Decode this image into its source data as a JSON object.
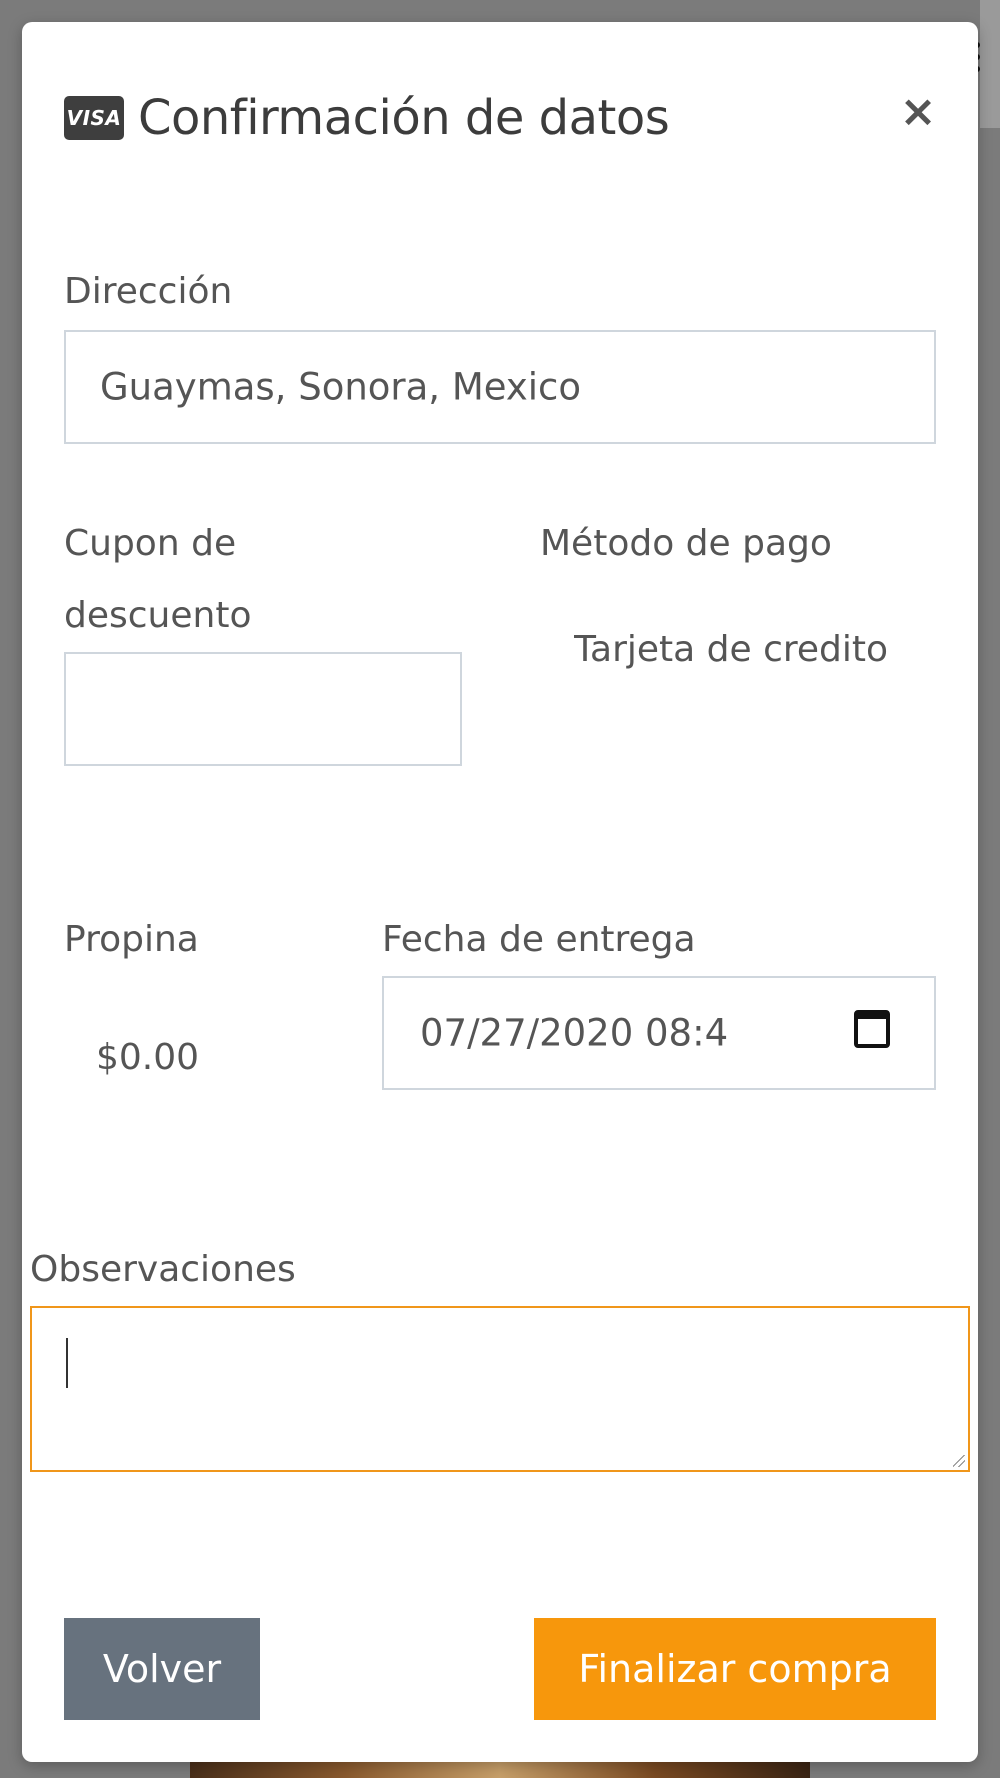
{
  "modal": {
    "title": "Confirmación de datos",
    "close_label": "×",
    "card_brand": "VISA"
  },
  "address": {
    "label": "Dirección",
    "value": "Guaymas, Sonora, Mexico"
  },
  "coupon": {
    "label_line1": "Cupon de",
    "label_line2": "descuento",
    "value": ""
  },
  "payment": {
    "label": "Método de pago",
    "value": "Tarjeta de credito"
  },
  "tip": {
    "label": "Propina",
    "value": "$0.00"
  },
  "delivery": {
    "label": "Fecha de entrega",
    "value": "07/27/2020 08:4"
  },
  "notes": {
    "label": "Observaciones",
    "value": ""
  },
  "actions": {
    "back_label": "Volver",
    "finish_label": "Finalizar compra"
  },
  "colors": {
    "accent": "#f7970c",
    "secondary": "#67727e",
    "focus_border": "#f0961a"
  }
}
